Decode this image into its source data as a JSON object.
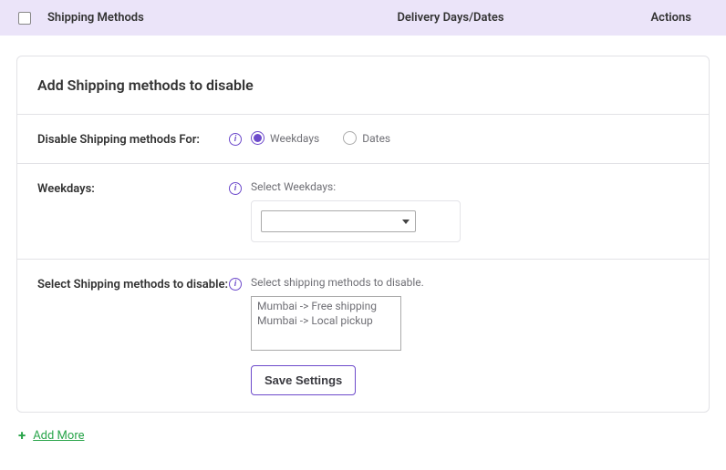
{
  "header": {
    "shipping_methods": "Shipping Methods",
    "delivery_days": "Delivery Days/Dates",
    "actions": "Actions"
  },
  "panel": {
    "title": "Add Shipping methods to disable",
    "disable_for": {
      "label": "Disable Shipping methods For:",
      "weekdays_label": "Weekdays",
      "dates_label": "Dates",
      "selected": "weekdays"
    },
    "weekdays_row": {
      "label": "Weekdays:",
      "field_label": "Select Weekdays:",
      "value": ""
    },
    "methods_row": {
      "label": "Select Shipping methods to disable:",
      "field_label": "Select shipping methods to disable.",
      "options": [
        "Mumbai -> Free shipping",
        "Mumbai -> Local pickup"
      ]
    },
    "save_button": "Save Settings"
  },
  "add_more": "Add More"
}
